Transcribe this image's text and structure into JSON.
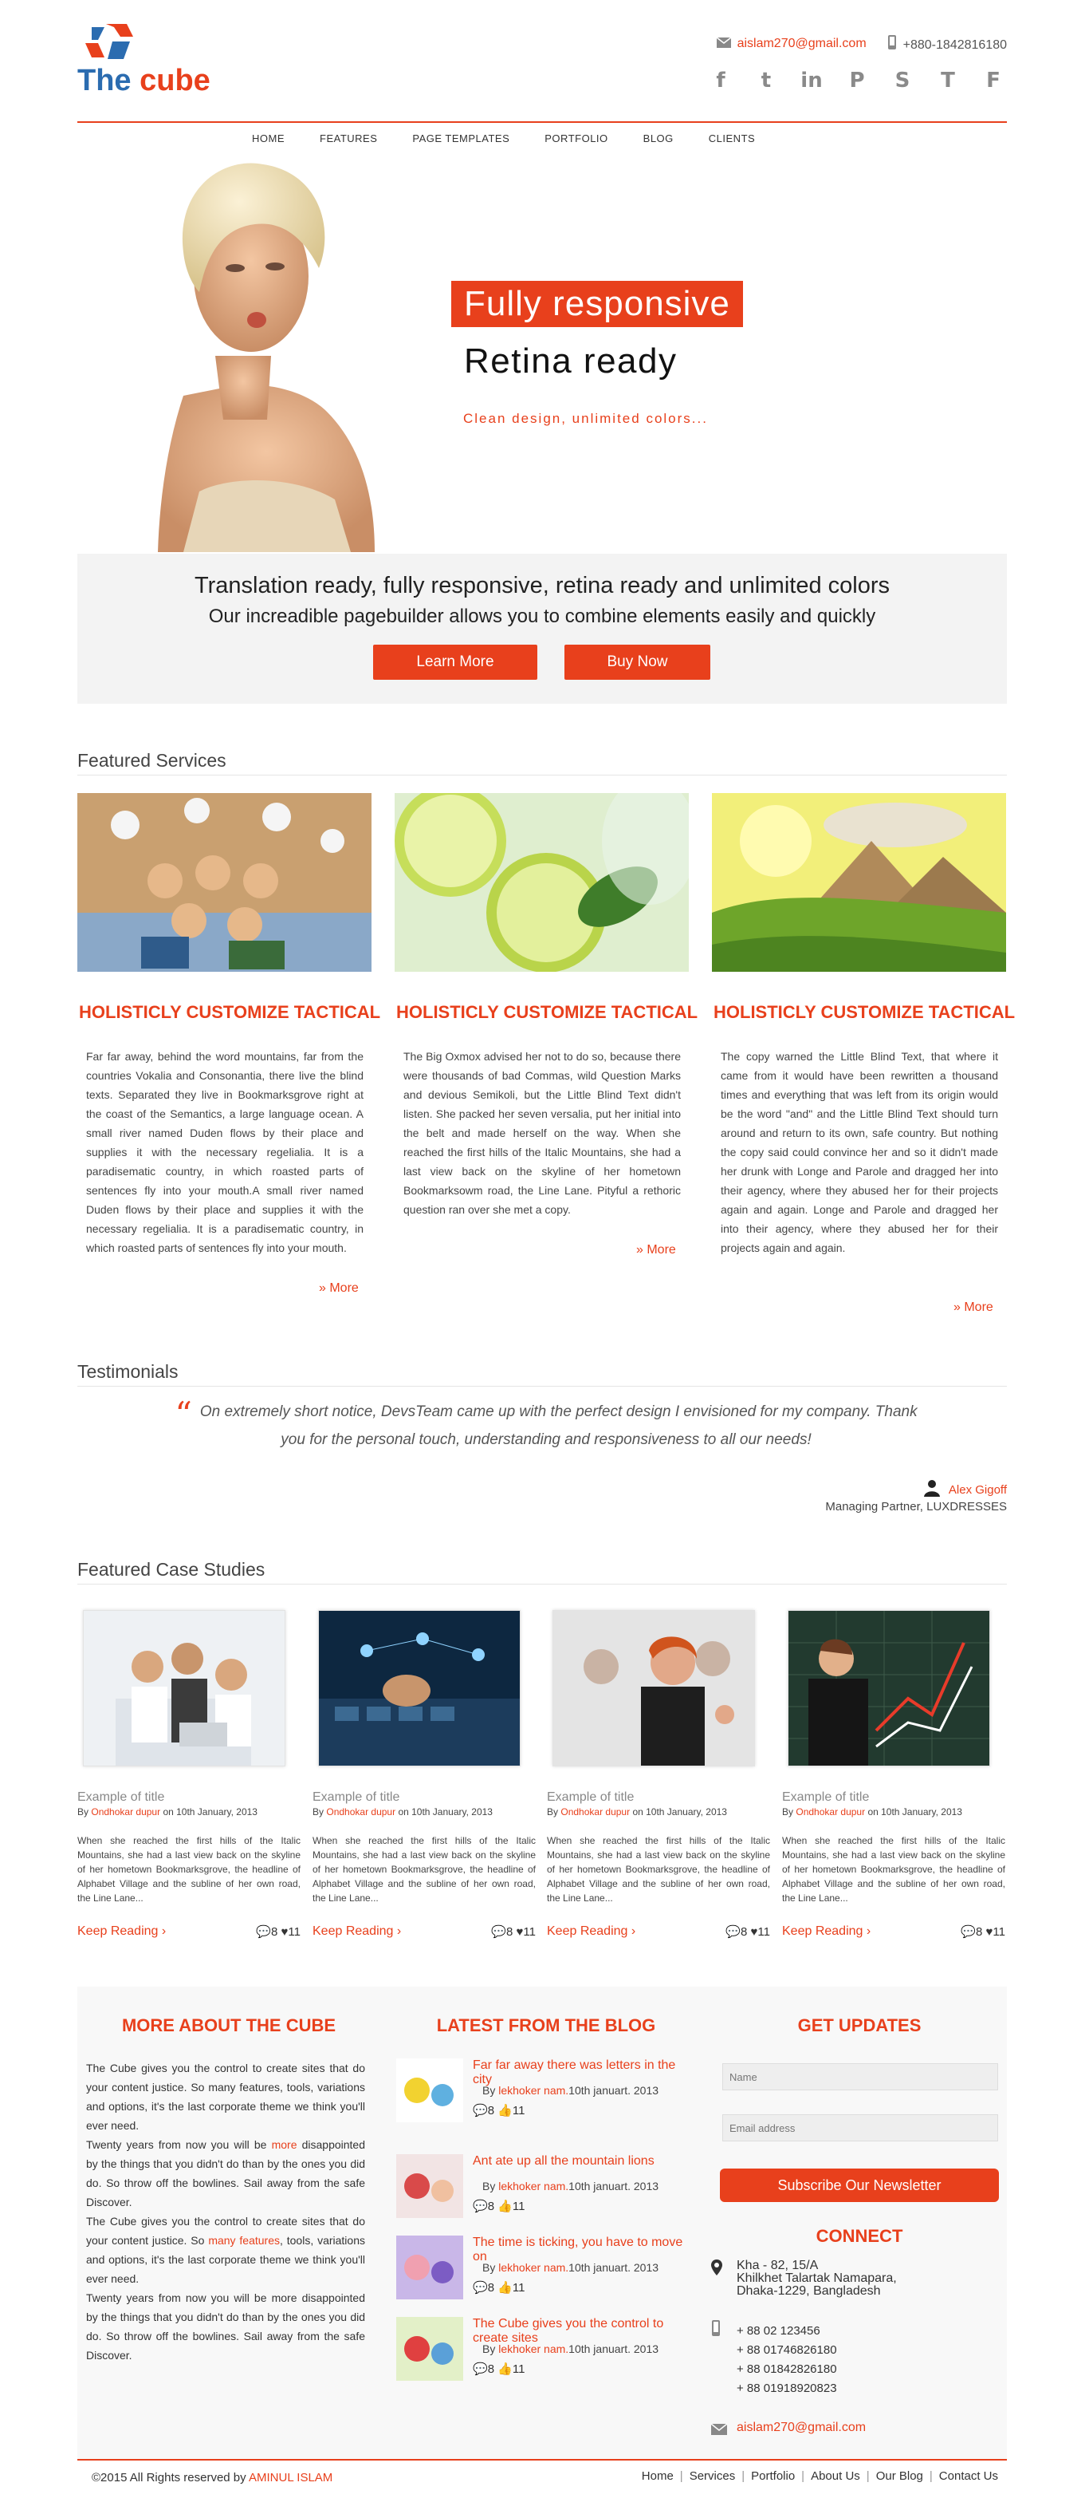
{
  "header": {
    "logo": {
      "the": "The",
      "cube": "cube"
    },
    "email": "aislam270@gmail.com",
    "phone": "+880-1842816180",
    "socials": [
      {
        "name": "facebook-icon",
        "glyph": "f"
      },
      {
        "name": "twitter-icon",
        "glyph": "t"
      },
      {
        "name": "linkedin-icon",
        "glyph": "in"
      },
      {
        "name": "pinterest-icon",
        "glyph": "P"
      },
      {
        "name": "stumbleupon-icon",
        "glyph": "S"
      },
      {
        "name": "nytimes-icon",
        "glyph": "T"
      },
      {
        "name": "foxnews-icon",
        "glyph": "F"
      }
    ]
  },
  "nav": [
    "HOME",
    "FEATURES",
    "PAGE TEMPLATES",
    "PORTFOLIO",
    "BLOG",
    "CLIENTS"
  ],
  "hero": {
    "title": "Fully responsive",
    "subtitle": "Retina ready",
    "tagline": "Clean design, unlimited colors..."
  },
  "promo": {
    "heading": "Translation ready, fully responsive, retina ready and unlimited colors",
    "text": "Our increadible pagebuilder allows you to combine elements easily and quickly",
    "learn_more": "Learn More",
    "buy_now": "Buy Now"
  },
  "services": {
    "heading": "Featured Services",
    "more": "More",
    "items": [
      {
        "title": "HOLISTICLY CUSTOMIZE TACTICAL",
        "text": "Far far away, behind the word mountains, far from the countries Vokalia and Consonantia, there live the blind texts. Separated they live in Bookmarksgrove right at the coast of the Semantics, a large language ocean. A small river named Duden flows by their place and supplies it with the necessary regelialia. It is a paradisematic country, in which roasted parts of sentences fly into your mouth.A small river named Duden flows by their place and supplies it with the necessary regelialia. It is a paradisematic country, in which roasted parts of sentences fly into your mouth."
      },
      {
        "title": "HOLISTICLY CUSTOMIZE TACTICAL",
        "text": "The Big Oxmox advised her not to do so, because there were thousands of bad Commas, wild Question Marks and devious Semikoli, but the Little Blind Text didn't listen. She packed her seven versalia, put her initial into the belt and made herself on the way. When she reached the first hills of the Italic Mountains, she had a last view back on the skyline of her hometown Bookmarksowm road, the Line Lane. Pityful a rethoric question ran over she met a copy."
      },
      {
        "title": "HOLISTICLY CUSTOMIZE TACTICAL",
        "text": "The copy warned the Little Blind Text, that where it came from it would have been rewritten a thousand times and everything that was left from its origin would be the word \"and\" and the Little Blind Text should turn around and return to its own, safe country. But nothing the copy said could convince her and so it didn't made her drunk with Longe and Parole and dragged her into their agency, where they abused her for their projects again and again. Longe and Parole and dragged her into their agency, where they abused her for their projects again and again."
      }
    ]
  },
  "testimonials": {
    "heading": "Testimonials",
    "quote": "On extremely short notice, DevsTeam came up with the perfect design I envisioned for my company. Thank you for the personal touch, understanding and responsiveness to all our needs!",
    "author": "Alex Gigoff",
    "role": "Managing Partner, LUXDRESSES"
  },
  "cases": {
    "heading": "Featured Case Studies",
    "keep_reading": "Keep Reading",
    "items": [
      {
        "title": "Example of title",
        "by": "By",
        "author": "Ondhokar dupur",
        "date": "on 10th January, 2013",
        "text": "When she reached the first hills of the Italic Mountains, she had a last view back on the skyline of her hometown Bookmarksgrove, the headline of Alphabet Village and the subline of her own road, the Line Lane...",
        "comments": "8",
        "likes": "11"
      },
      {
        "title": "Example of title",
        "by": "By",
        "author": "Ondhokar dupur",
        "date": "on 10th January, 2013",
        "text": "When she reached the first hills of the Italic Mountains, she had a last view back on the skyline of her hometown Bookmarksgrove, the headline of Alphabet Village and the subline of her own road, the Line Lane...",
        "comments": "8",
        "likes": "11"
      },
      {
        "title": "Example of title",
        "by": "By",
        "author": "Ondhokar dupur",
        "date": "on 10th January, 2013",
        "text": "When she reached the first hills of the Italic Mountains, she had a last view back on the skyline of her hometown Bookmarksgrove, the headline of Alphabet Village and the subline of her own road, the Line Lane...",
        "comments": "8",
        "likes": "11"
      },
      {
        "title": "Example of title",
        "by": "By",
        "author": "Ondhokar dupur",
        "date": "on 10th January, 2013",
        "text": "When she reached the first hills of the Italic Mountains, she had a last view back on the skyline of her hometown Bookmarksgrove, the headline of Alphabet Village and the subline of her own road, the Line Lane...",
        "comments": "8",
        "likes": "11"
      }
    ]
  },
  "about": {
    "heading": "MORE ABOUT THE CUBE",
    "p1": "The Cube gives you the control to create sites that do your content justice. So many features, tools, variations and options, it's the last corporate theme we think you'll ever need.",
    "p2a": "Twenty years from now you will be",
    "p2link": "more",
    "p2b": "disappointed by the things that you didn't do than by the ones you did do. So throw off the bowlines. Sail away from the safe Discover.",
    "p3a": "The Cube gives you the control to create sites that do your content justice. So",
    "p3link": "many features",
    "p3b": ", tools, variations and options, it's the last corporate theme we think you'll ever need.",
    "p4": "Twenty years from now you will be more disappointed by the things that you didn't do than by the ones you did do. So throw off the bowlines. Sail away from the safe Discover."
  },
  "blog": {
    "heading": "LATEST FROM THE BLOG",
    "items": [
      {
        "title": "Far far away there was letters in the city",
        "by": "By",
        "author": "lekhoker nam.",
        "date": "10th januart. 2013",
        "comments": "8",
        "likes": "11"
      },
      {
        "title": "Ant ate up all the mountain lions",
        "by": "By",
        "author": "lekhoker nam.",
        "date": "10th januart. 2013",
        "comments": "8",
        "likes": "11"
      },
      {
        "title": "The time is ticking, you have to move on",
        "by": "By",
        "author": "lekhoker nam.",
        "date": "10th januart. 2013",
        "comments": "8",
        "likes": "11"
      },
      {
        "title": "The Cube gives you the control to create sites",
        "by": "By",
        "author": "lekhoker nam.",
        "date": "10th januart. 2013",
        "comments": "8",
        "likes": "11"
      }
    ]
  },
  "updates": {
    "heading": "GET UPDATES",
    "name_placeholder": "Name",
    "email_placeholder": "Email address",
    "subscribe": "Subscribe Our Newsletter",
    "connect": "CONNECT",
    "address": [
      "Kha - 82, 15/A",
      "Khilkhet Talartak Namapara,",
      "Dhaka-1229, Bangladesh"
    ],
    "phones": [
      "+ 88 02 123456",
      "+ 88 01746826180",
      "+ 88 01842826180",
      "+ 88 01918920823"
    ],
    "email": "aislam270@gmail.com"
  },
  "footer": {
    "copyright": "©2015 All Rights reserved by",
    "owner": "AMINUL ISLAM",
    "links": [
      "Home",
      "Services",
      "Portfolio",
      "About Us",
      "Our Blog",
      "Contact Us"
    ]
  },
  "colors": {
    "accent": "#e8401c",
    "brand_blue": "#2b6cb0",
    "panel": "#f3f3f3"
  }
}
